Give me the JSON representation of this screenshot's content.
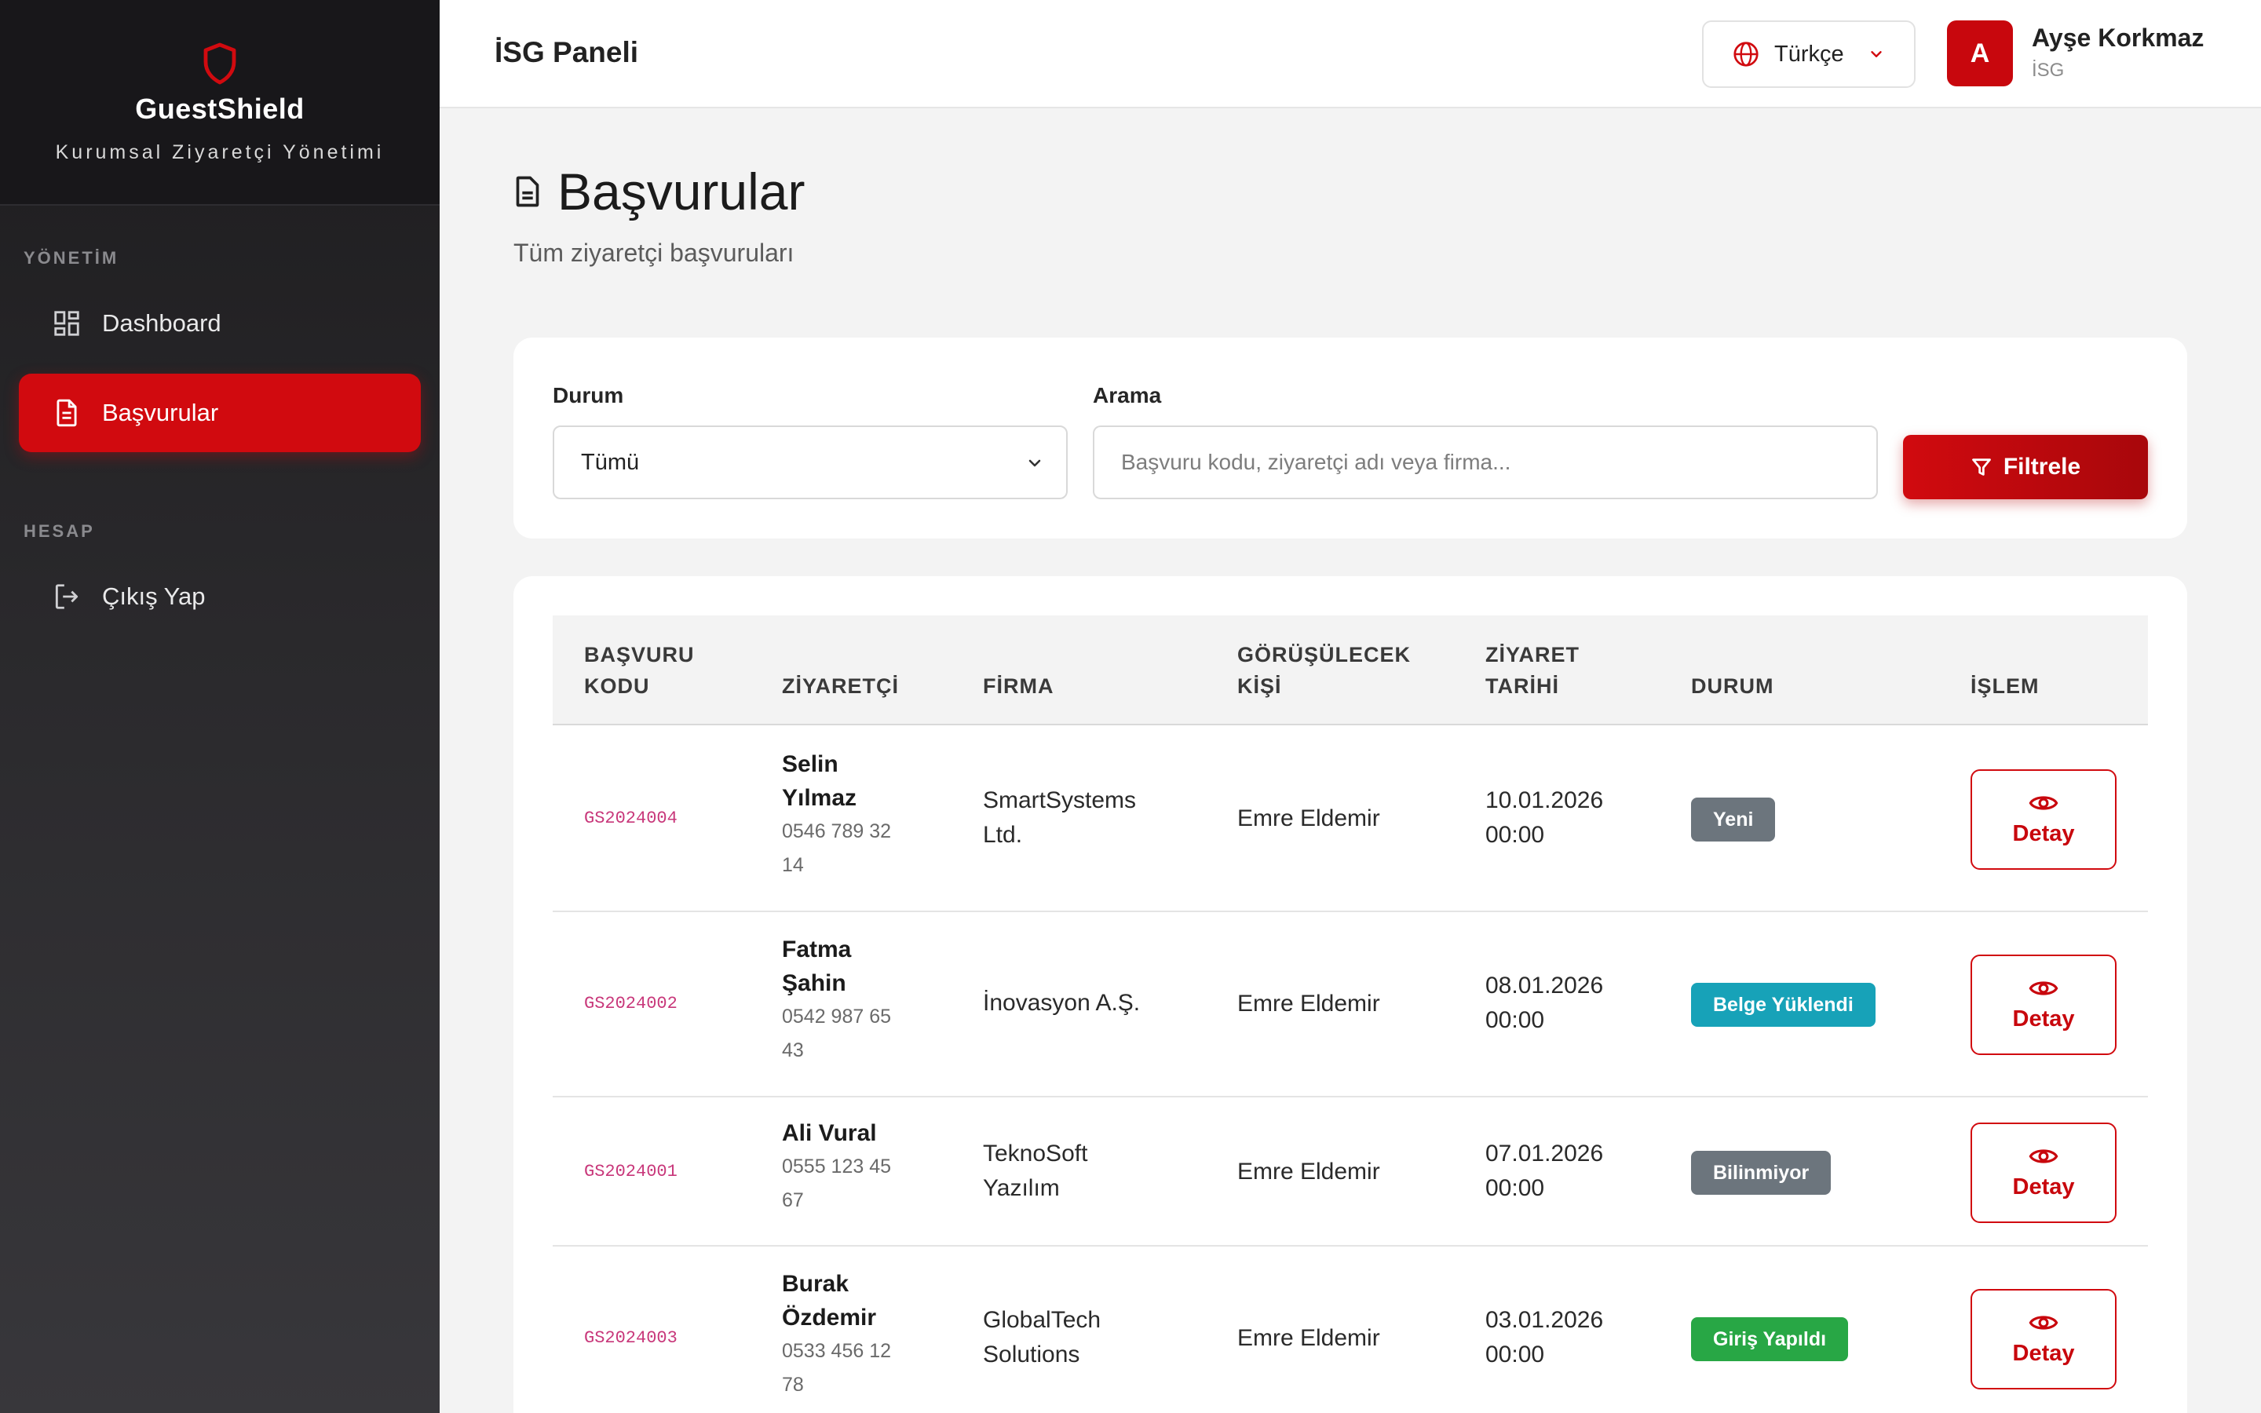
{
  "brand": {
    "name": "GuestShield",
    "subtitle": "Kurumsal Ziyaretçi Yönetimi",
    "accent": "#d10a0f"
  },
  "sidebar": {
    "sections": [
      {
        "title": "YÖNETİM",
        "items": [
          {
            "label": "Dashboard",
            "icon": "dashboard-icon",
            "active": false
          },
          {
            "label": "Başvurular",
            "icon": "document-icon",
            "active": true
          }
        ]
      },
      {
        "title": "HESAP",
        "items": [
          {
            "label": "Çıkış Yap",
            "icon": "logout-icon",
            "active": false
          }
        ]
      }
    ]
  },
  "header": {
    "title": "İSG Paneli",
    "language": "Türkçe",
    "user": {
      "initial": "A",
      "name": "Ayşe Korkmaz",
      "role": "İSG"
    }
  },
  "page": {
    "title": "Başvurular",
    "subtitle": "Tüm ziyaretçi başvuruları"
  },
  "filter": {
    "status_label": "Durum",
    "status_value": "Tümü",
    "search_label": "Arama",
    "search_placeholder": "Başvuru kodu, ziyaretçi adı veya firma...",
    "button_label": "Filtrele"
  },
  "table": {
    "columns": [
      {
        "line1": "BAŞVURU",
        "line2": "KODU"
      },
      {
        "line1": "",
        "line2": "ZİYARETÇİ"
      },
      {
        "line1": "",
        "line2": "FİRMA"
      },
      {
        "line1": "GÖRÜŞÜLECEK",
        "line2": "KİŞİ"
      },
      {
        "line1": "ZİYARET",
        "line2": "TARİHİ"
      },
      {
        "line1": "",
        "line2": "DURUM"
      },
      {
        "line1": "",
        "line2": "İŞLEM"
      }
    ],
    "rows": [
      {
        "code": "GS2024004",
        "name_line1": "Selin",
        "name_line2": "Yılmaz",
        "phone_line1": "0546 789 32",
        "phone_line2": "14",
        "firm_line1": "SmartSystems",
        "firm_line2": "Ltd.",
        "person": "Emre Eldemir",
        "date": "10.01.2026",
        "time": "00:00",
        "status": "Yeni",
        "status_color": "#6c757d",
        "action": "Detay"
      },
      {
        "code": "GS2024002",
        "name_line1": "Fatma",
        "name_line2": "Şahin",
        "phone_line1": "0542 987 65",
        "phone_line2": "43",
        "firm_line1": "İnovasyon A.Ş.",
        "firm_line2": "",
        "person": "Emre Eldemir",
        "date": "08.01.2026",
        "time": "00:00",
        "status": "Belge Yüklendi",
        "status_color": "#17a2b8",
        "action": "Detay"
      },
      {
        "code": "GS2024001",
        "name_line1": "Ali Vural",
        "name_line2": "",
        "phone_line1": "0555 123 45",
        "phone_line2": "67",
        "firm_line1": "TeknoSoft",
        "firm_line2": "Yazılım",
        "person": "Emre Eldemir",
        "date": "07.01.2026",
        "time": "00:00",
        "status": "Bilinmiyor",
        "status_color": "#6c757d",
        "action": "Detay"
      },
      {
        "code": "GS2024003",
        "name_line1": "Burak",
        "name_line2": "Özdemir",
        "phone_line1": "0533 456 12",
        "phone_line2": "78",
        "firm_line1": "GlobalTech",
        "firm_line2": "Solutions",
        "person": "Emre Eldemir",
        "date": "03.01.2026",
        "time": "00:00",
        "status": "Giriş Yapıldı",
        "status_color": "#28a745",
        "action": "Detay"
      }
    ]
  }
}
